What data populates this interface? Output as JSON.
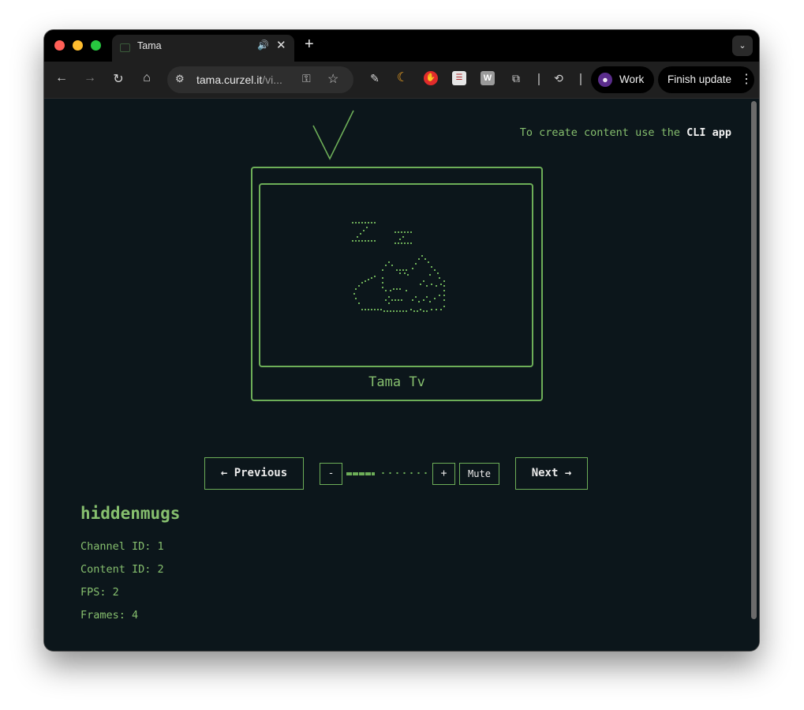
{
  "browser": {
    "tab": {
      "title": "Tama"
    },
    "omnibox": {
      "url_host": "tama.curzel.it",
      "url_path": "/vi..."
    },
    "profile": {
      "label": "Work"
    },
    "update_button": {
      "label": "Finish update"
    },
    "icons": {
      "back": "←",
      "forward": "→",
      "reload": "↻",
      "home": "⌂",
      "tune": "⚙",
      "key": "⚿",
      "star": "☆",
      "dropper": "✎",
      "moon": "☾",
      "stop": "✋",
      "list": "☰",
      "w": "W",
      "puzzle": "⧉",
      "history": "⟲",
      "audio": "🔊",
      "close": "✕",
      "new_tab": "+",
      "dropdown": "⌄",
      "more": "⋮",
      "avatar": "☻"
    }
  },
  "page": {
    "cli_note": {
      "prefix": "To create content use the ",
      "link": "CLI app"
    },
    "tv": {
      "label": "Tama Tv",
      "art": "⠒⠒⠒\n ⠔ ⠒⠒\n⠒⠒⠒  ⠔\n      ⢀⠎⢣\n   ⢀⠜⠙⢳⢿⢀⠑\n ⡔⠉ ⡇⣀⣀ ⣀⢿\n ⠱⡀ ⠑⣛⣛⠑⣀⡸\n  ⠈⠉⠉⠉⠉⠉⠉⠁"
    },
    "controls": {
      "previous": "← Previous",
      "next": "Next →",
      "volume_down": "-",
      "volume_up": "+",
      "mute": "Mute",
      "volume_level": 0.35
    },
    "channel": {
      "name": "hiddenmugs",
      "channel_id": "Channel ID: 1",
      "content_id": "Content ID: 2",
      "fps": "FPS: 2",
      "frames": "Frames: 4"
    }
  }
}
